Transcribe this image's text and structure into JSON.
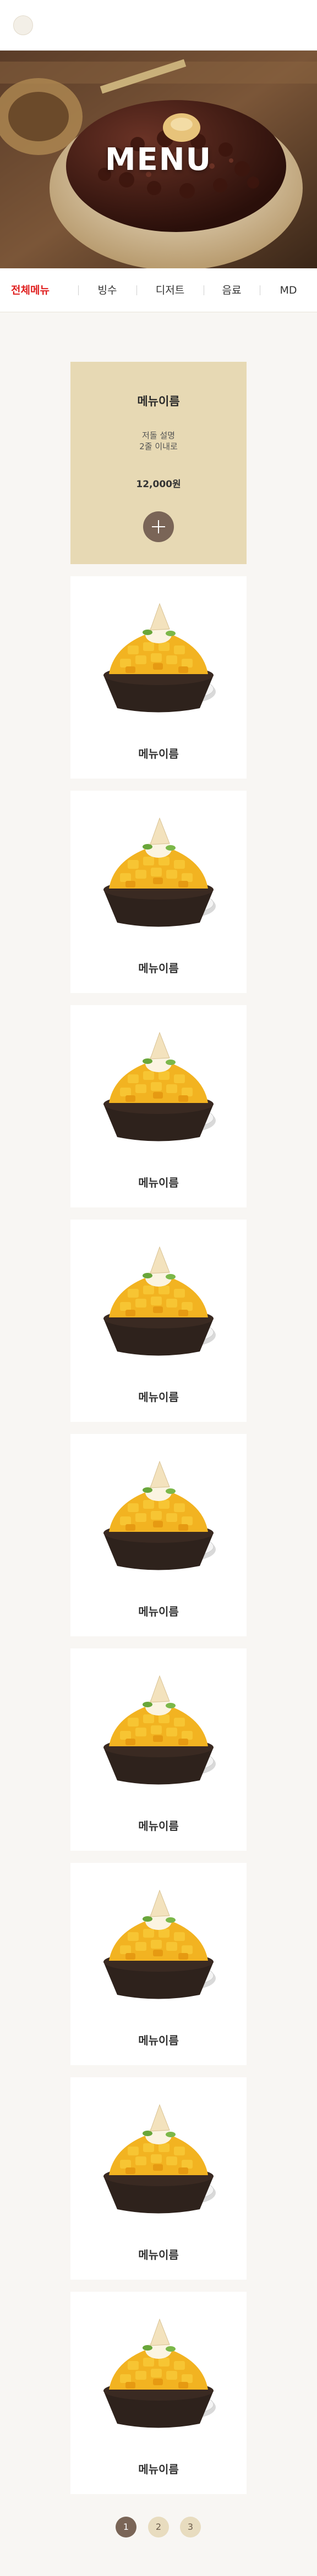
{
  "hero": {
    "title": "MENU"
  },
  "tabs": [
    {
      "label": "전체메뉴"
    },
    {
      "label": "빙수"
    },
    {
      "label": "디저트"
    },
    {
      "label": "음료"
    },
    {
      "label": "MD"
    }
  ],
  "featured": {
    "name": "메뉴이름",
    "description_line1": "저돌 설명",
    "description_line2": "2줄 이내로",
    "price": "12,000원",
    "add_icon": "plus-icon"
  },
  "menu_items": [
    {
      "name": "메뉴이름"
    },
    {
      "name": "메뉴이름"
    },
    {
      "name": "메뉴이름"
    },
    {
      "name": "메뉴이름"
    },
    {
      "name": "메뉴이름"
    },
    {
      "name": "메뉴이름"
    },
    {
      "name": "메뉴이름"
    },
    {
      "name": "메뉴이름"
    },
    {
      "name": "메뉴이름"
    }
  ],
  "pagination": {
    "pages": [
      "1",
      "2",
      "3"
    ],
    "current": "1"
  },
  "colors": {
    "active_tab": "#e02020",
    "featured_bg": "#e7d9b4",
    "accent_brown": "#7a6557",
    "page_inactive": "#e8dcbf",
    "page_bg": "#f8f6f3"
  }
}
